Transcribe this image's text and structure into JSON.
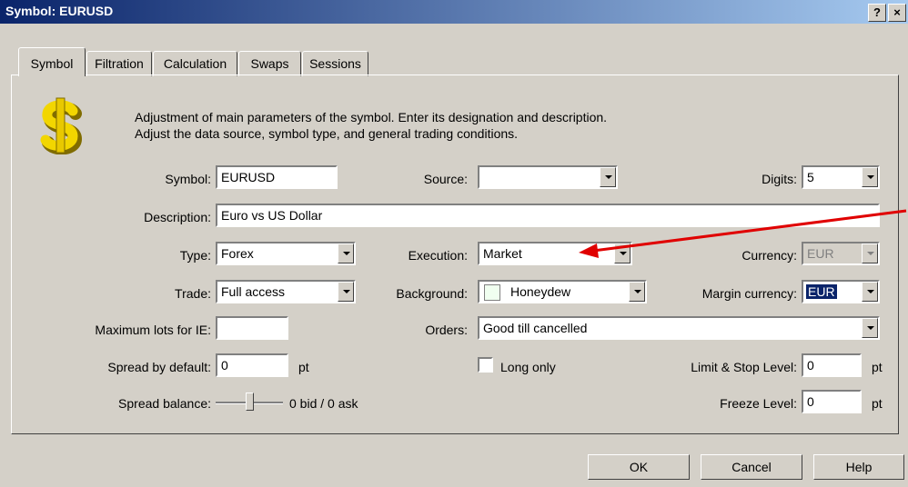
{
  "window": {
    "title": "Symbol: EURUSD",
    "help_btn": "?",
    "close_btn": "×"
  },
  "tabs": [
    "Symbol",
    "Filtration",
    "Calculation",
    "Swaps",
    "Sessions"
  ],
  "intro": {
    "line1": "Adjustment of main parameters of the symbol. Enter its designation and description.",
    "line2": "Adjust the data source, symbol type, and general trading conditions."
  },
  "fields": {
    "symbol": {
      "label": "Symbol:",
      "value": "EURUSD"
    },
    "source": {
      "label": "Source:",
      "value": ""
    },
    "digits": {
      "label": "Digits:",
      "value": "5"
    },
    "description": {
      "label": "Description:",
      "value": "Euro vs US Dollar"
    },
    "type": {
      "label": "Type:",
      "value": "Forex"
    },
    "execution": {
      "label": "Execution:",
      "value": "Market"
    },
    "currency": {
      "label": "Currency:",
      "value": "EUR"
    },
    "trade": {
      "label": "Trade:",
      "value": "Full access"
    },
    "background": {
      "label": "Background:",
      "value": "Honeydew",
      "swatch": "#f0fff0"
    },
    "margin_currency": {
      "label": "Margin currency:",
      "value": "EUR"
    },
    "max_lots": {
      "label": "Maximum lots for IE:",
      "value": ""
    },
    "orders": {
      "label": "Orders:",
      "value": "Good till cancelled"
    },
    "spread_default": {
      "label": "Spread by default:",
      "value": "0",
      "unit": "pt"
    },
    "long_only": {
      "label": "Long only"
    },
    "limit_stop": {
      "label": "Limit & Stop Level:",
      "value": "0",
      "unit": "pt"
    },
    "spread_balance": {
      "label": "Spread balance:",
      "value": "0 bid / 0 ask"
    },
    "freeze": {
      "label": "Freeze Level:",
      "value": "0",
      "unit": "pt"
    }
  },
  "buttons": {
    "ok": "OK",
    "cancel": "Cancel",
    "help": "Help"
  },
  "colors": {
    "title_bar": "#0a246a",
    "arrow": "#e00000",
    "selection": "#0a246a"
  }
}
